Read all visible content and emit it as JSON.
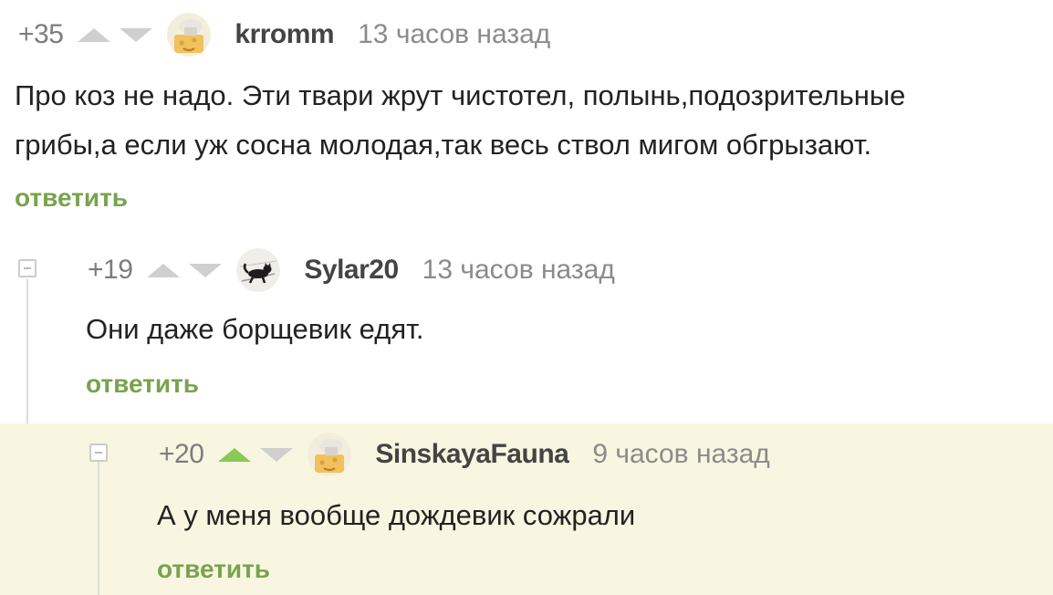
{
  "comments": [
    {
      "rating": "+35",
      "username": "krromm",
      "time": "13 часов назад",
      "text_lines": [
        "Про коз не надо. Эти твари жрут чистотел, полынь,подозрительные",
        "грибы,а если уж сосна молодая,так весь ствол мигом обгрызают."
      ],
      "reply_label": "ответить",
      "avatar": "cheese-face-avatar"
    },
    {
      "rating": "+19",
      "username": "Sylar20",
      "time": "13 часов назад",
      "text": "Они даже борщевик едят.",
      "reply_label": "ответить",
      "avatar": "black-cat-avatar"
    },
    {
      "rating": "+20",
      "username": "SinskayaFauna",
      "time": "9 часов назад",
      "text": "А у меня вообще дождевик сожрали",
      "reply_label": "ответить",
      "avatar": "cheese-face-avatar",
      "upvoted": true
    }
  ],
  "colors": {
    "upvote_active": "#8ac858",
    "reply_link": "#78a34e",
    "highlight_background": "#f8f6e1"
  }
}
